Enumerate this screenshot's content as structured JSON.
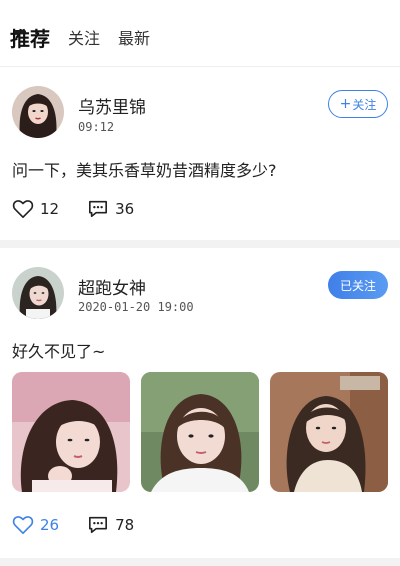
{
  "tabs": [
    {
      "label": "推荐",
      "active": true
    },
    {
      "label": "关注",
      "active": false
    },
    {
      "label": "最新",
      "active": false
    }
  ],
  "posts": [
    {
      "user": "乌苏里锦",
      "time": "09:12",
      "follow_label": "关注",
      "follow_state": "not_following",
      "text": "问一下，美其乐香草奶昔酒精度多少?",
      "likes": "12",
      "comments": "36",
      "liked": false,
      "avatar_icon": "avatar-photo"
    },
    {
      "user": "超跑女神",
      "time": "2020-01-20 19:00",
      "follow_label": "已关注",
      "follow_state": "following",
      "text": "好久不见了~",
      "likes": "26",
      "comments": "78",
      "liked": true,
      "avatar_icon": "avatar-photo",
      "photos": [
        "photo-1",
        "photo-2",
        "photo-3"
      ]
    }
  ],
  "colors": {
    "accent": "#3e82e8",
    "divider": "#f2f2f2"
  }
}
